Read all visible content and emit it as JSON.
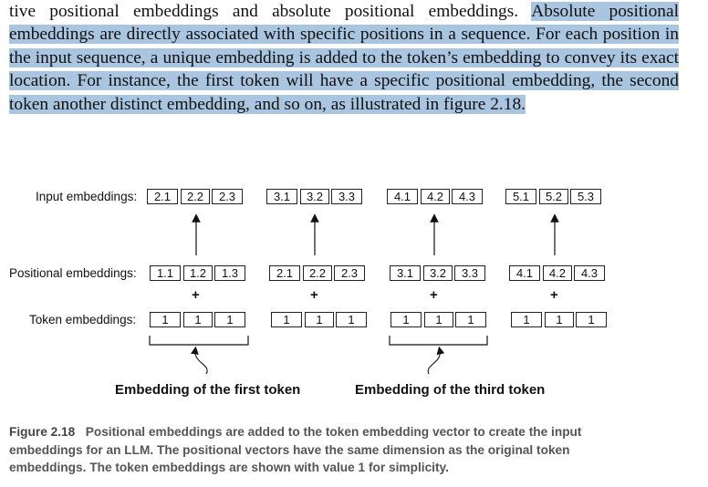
{
  "paragraph": {
    "plain": "tive positional embeddings and absolute positional embeddings. ",
    "highlighted": "Absolute positional embeddings are directly associated with specific positions in a sequence. For each position in the input sequence, a unique embedding is added to the token’s embedding to convey its exact location. For instance, the first token will have a specific positional embedding, the second token another distinct embedding, and so on, as illustrated in figure 2.18."
  },
  "diagram": {
    "labels": {
      "input": "Input embeddings:",
      "positional": "Positional embeddings:",
      "token": "Token embeddings:"
    },
    "input_rows": [
      [
        "2.1",
        "2.2",
        "2.3"
      ],
      [
        "3.1",
        "3.2",
        "3.3"
      ],
      [
        "4.1",
        "4.2",
        "4.3"
      ],
      [
        "5.1",
        "5.2",
        "5.3"
      ]
    ],
    "positional_rows": [
      [
        "1.1",
        "1.2",
        "1.3"
      ],
      [
        "2.1",
        "2.2",
        "2.3"
      ],
      [
        "3.1",
        "3.2",
        "3.3"
      ],
      [
        "4.1",
        "4.2",
        "4.3"
      ]
    ],
    "token_rows": [
      [
        "1",
        "1",
        "1"
      ],
      [
        "1",
        "1",
        "1"
      ],
      [
        "1",
        "1",
        "1"
      ],
      [
        "1",
        "1",
        "1"
      ]
    ],
    "plus": "+",
    "annotation_first": "Embedding of the first token",
    "annotation_third": "Embedding of the third token"
  },
  "caption": {
    "figure_number": "Figure 2.18",
    "text": "Positional embeddings are added to the token embedding vector to create the input embeddings for an LLM. The positional vectors have the same dimension as the original token embeddings. The token embeddings are shown with value 1 for simplicity."
  }
}
